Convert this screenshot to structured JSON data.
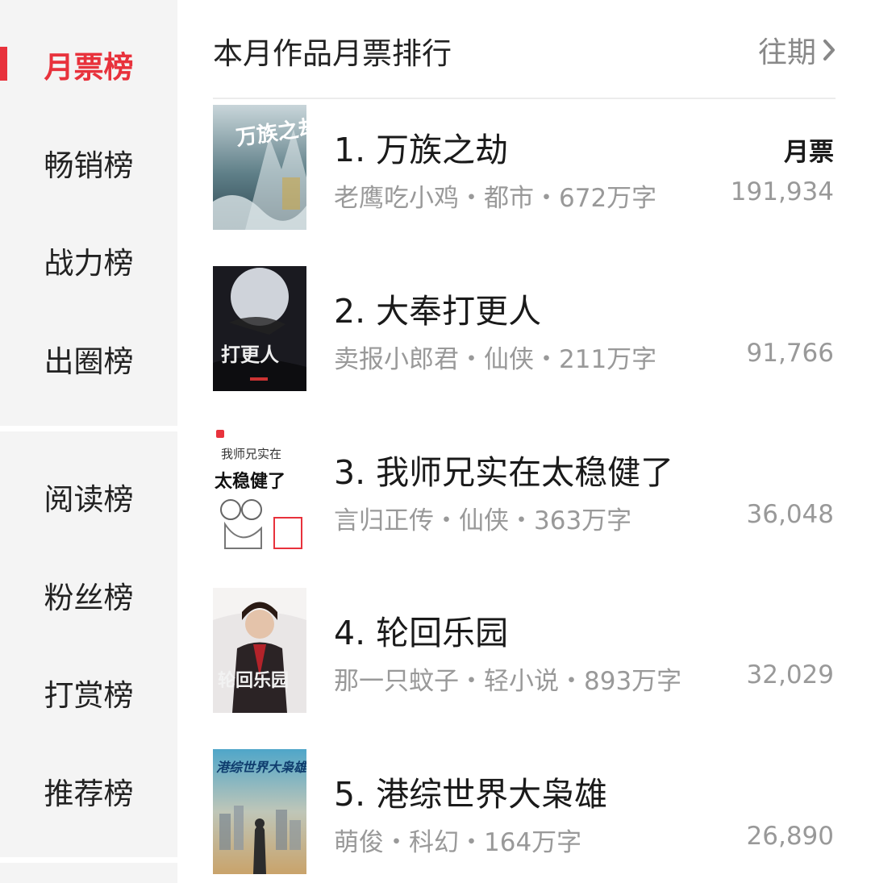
{
  "sidebar": {
    "items": [
      {
        "label": "月票榜",
        "active": true
      },
      {
        "label": "畅销榜"
      },
      {
        "label": "战力榜"
      },
      {
        "label": "出圈榜"
      },
      {
        "label": "阅读榜"
      },
      {
        "label": "粉丝榜"
      },
      {
        "label": "打赏榜"
      },
      {
        "label": "推荐榜"
      }
    ]
  },
  "header": {
    "title": "本月作品月票排行",
    "history_label": "往期"
  },
  "colors": {
    "accent": "#e8323c",
    "muted": "#999999"
  },
  "books": [
    {
      "rank_title": "1. 万族之劫",
      "meta": "老鹰吃小鸡・都市・672万字",
      "votes_label": "月票",
      "votes": "191,934",
      "cover_text": "万族之劫",
      "cover_icon": "book-cover-ice-mountain"
    },
    {
      "rank_title": "2. 大奉打更人",
      "meta": "卖报小郎君・仙侠・211万字",
      "votes": "91,766",
      "cover_text": "打更人",
      "cover_icon": "book-cover-moon-night"
    },
    {
      "rank_title": "3. 我师兄实在太稳健了",
      "meta": "言归正传・仙侠・363万字",
      "votes": "36,048",
      "cover_text": "太稳健了",
      "cover_text2": "我师兄实在",
      "cover_icon": "book-cover-sketch"
    },
    {
      "rank_title": "4. 轮回乐园",
      "meta": "那一只蚊子・轻小说・893万字",
      "votes": "32,029",
      "cover_text": "轮回乐园",
      "cover_icon": "book-cover-character"
    },
    {
      "rank_title": "5. 港综世界大枭雄",
      "meta": "萌俊・科幻・164万字",
      "votes": "26,890",
      "cover_text": "港综世界大枭雄",
      "cover_icon": "book-cover-city"
    }
  ]
}
